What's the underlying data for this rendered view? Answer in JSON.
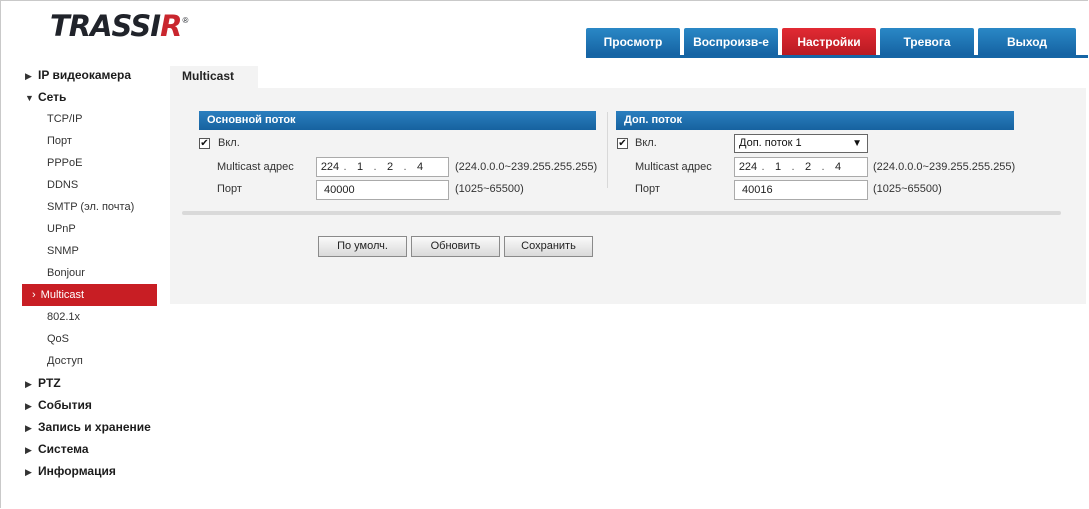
{
  "logo": {
    "text_main": "TRASSI",
    "text_accent": "R",
    "registered": "®"
  },
  "nav": {
    "tabs": [
      {
        "label": "Просмотр",
        "active": false
      },
      {
        "label": "Воспроизв-е",
        "active": false
      },
      {
        "label": "Настройки",
        "active": true
      },
      {
        "label": "Тревога",
        "active": false
      },
      {
        "label": "Выход",
        "active": false
      }
    ]
  },
  "sidebar": {
    "items": [
      {
        "label": "IP видеокамера",
        "level": 0,
        "expanded": false
      },
      {
        "label": "Сеть",
        "level": 0,
        "expanded": true
      },
      {
        "label": "TCP/IP",
        "level": 1
      },
      {
        "label": "Порт",
        "level": 1
      },
      {
        "label": "PPPoE",
        "level": 1
      },
      {
        "label": "DDNS",
        "level": 1
      },
      {
        "label": "SMTP (эл. почта)",
        "level": 1
      },
      {
        "label": "UPnP",
        "level": 1
      },
      {
        "label": "SNMP",
        "level": 1
      },
      {
        "label": "Bonjour",
        "level": 1
      },
      {
        "label": "Multicast",
        "level": 1,
        "active": true
      },
      {
        "label": "802.1x",
        "level": 1
      },
      {
        "label": "QoS",
        "level": 1
      },
      {
        "label": "Доступ",
        "level": 1
      },
      {
        "label": "PTZ",
        "level": 0,
        "expanded": false
      },
      {
        "label": "События",
        "level": 0,
        "expanded": false
      },
      {
        "label": "Запись и хранение",
        "level": 0,
        "expanded": false
      },
      {
        "label": "Система",
        "level": 0,
        "expanded": false
      },
      {
        "label": "Информация",
        "level": 0,
        "expanded": false
      }
    ]
  },
  "page": {
    "tab_label": "Multicast"
  },
  "main_stream": {
    "header": "Основной поток",
    "enable_label": "Вкл.",
    "enabled": true,
    "address_label": "Multicast адрес",
    "address": [
      "224",
      "1",
      "2",
      "4"
    ],
    "address_range": "(224.0.0.0~239.255.255.255)",
    "port_label": "Порт",
    "port": "40000",
    "port_range": "(1025~65500)"
  },
  "sub_stream": {
    "header": "Доп. поток",
    "enable_label": "Вкл.",
    "enabled": true,
    "select_value": "Доп. поток 1",
    "address_label": "Multicast адрес",
    "address": [
      "224",
      "1",
      "2",
      "4"
    ],
    "address_range": "(224.0.0.0~239.255.255.255)",
    "port_label": "Порт",
    "port": "40016",
    "port_range": "(1025~65500)"
  },
  "buttons": {
    "default": "По умолч.",
    "refresh": "Обновить",
    "save": "Сохранить"
  },
  "colors": {
    "nav_blue": "#1565a5",
    "accent_red": "#c81e24",
    "panel_bg": "#f3f3f3"
  }
}
